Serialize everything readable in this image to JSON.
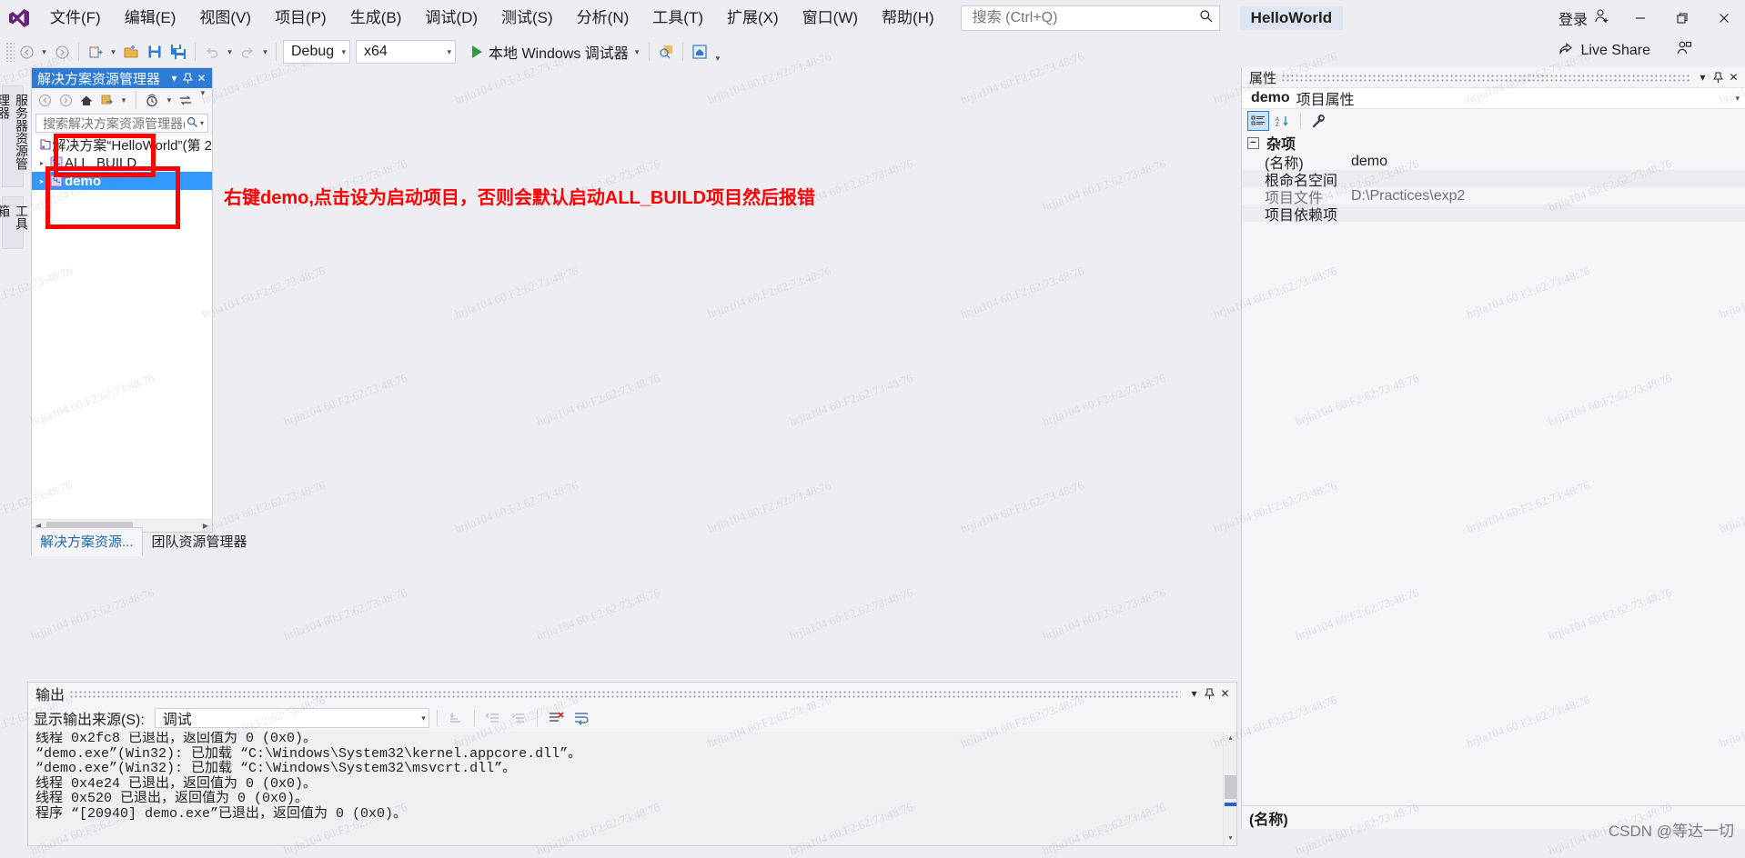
{
  "app": {
    "logo": "vs-logo",
    "project_chip": "HelloWorld",
    "signin_label": "登录",
    "live_share_label": "Live Share"
  },
  "menu": [
    {
      "label": "文件(F)",
      "key": "F"
    },
    {
      "label": "编辑(E)",
      "key": "E"
    },
    {
      "label": "视图(V)",
      "key": "V"
    },
    {
      "label": "项目(P)",
      "key": "P"
    },
    {
      "label": "生成(B)",
      "key": "B"
    },
    {
      "label": "调试(D)",
      "key": "D"
    },
    {
      "label": "测试(S)",
      "key": "S"
    },
    {
      "label": "分析(N)",
      "key": "N"
    },
    {
      "label": "工具(T)",
      "key": "T"
    },
    {
      "label": "扩展(X)",
      "key": "X"
    },
    {
      "label": "窗口(W)",
      "key": "W"
    },
    {
      "label": "帮助(H)",
      "key": "H"
    }
  ],
  "search": {
    "placeholder": "搜索 (Ctrl+Q)",
    "value": "",
    "icon": "search-icon"
  },
  "window_controls": {
    "minimize": "–",
    "maximize": "❐",
    "close": "✕"
  },
  "toolbar": {
    "configuration": "Debug",
    "platform": "x64",
    "run_label": "本地 Windows 调试器"
  },
  "left_strip": {
    "server_explorer": "服务器资源管理器",
    "toolbox": "工具箱"
  },
  "solution_explorer": {
    "title": "解决方案资源管理器",
    "search_placeholder": "搜索解决方案资源管理器(Ctr",
    "tree": [
      {
        "label": "解决方案“HelloWorld”(第 2 ",
        "icon": "solution-icon",
        "twisty": "",
        "selected": false,
        "depth": 0
      },
      {
        "label": "ALL_BUILD",
        "icon": "project-icon",
        "twisty": "▸",
        "selected": false,
        "depth": 1
      },
      {
        "label": "demo",
        "icon": "project-icon",
        "twisty": "▸",
        "selected": true,
        "depth": 1
      }
    ],
    "tabs": [
      {
        "label": "解决方案资源...",
        "active": true
      },
      {
        "label": "团队资源管理器",
        "active": false
      }
    ]
  },
  "annotation": {
    "text": "右键demo,点击设为启动项目，否则会默认启动ALL_BUILD项目然后报错",
    "color": "#FF0000"
  },
  "properties": {
    "title": "属性",
    "object_name": "demo",
    "object_suffix": "项目属性",
    "category": "杂项",
    "rows": [
      {
        "key": "(名称)",
        "value": "demo",
        "dim": false
      },
      {
        "key": "根命名空间",
        "value": "",
        "dim": false
      },
      {
        "key": "项目文件",
        "value": "D:\\Practices\\exp2",
        "dim": true
      },
      {
        "key": "项目依赖项",
        "value": "",
        "dim": false
      }
    ],
    "footer": "(名称)"
  },
  "output": {
    "title": "输出",
    "source_label": "显示输出来源(S):",
    "source_value": "调试",
    "lines": [
      "线程 0x2fc8 已退出，返回值为 0 (0x0)。",
      "“demo.exe”(Win32): 已加载 “C:\\Windows\\System32\\kernel.appcore.dll”。",
      "“demo.exe”(Win32): 已加载 “C:\\Windows\\System32\\msvcrt.dll”。",
      "线程 0x4e24 已退出，返回值为 0 (0x0)。",
      "线程 0x520 已退出，返回值为 0 (0x0)。",
      "程序 “[20940] demo.exe”已退出，返回值为 0 (0x0)。"
    ]
  },
  "watermark": {
    "text": "hrjia104 60:F2:62:73:48:76",
    "csdn": "CSDN @等达一切"
  }
}
